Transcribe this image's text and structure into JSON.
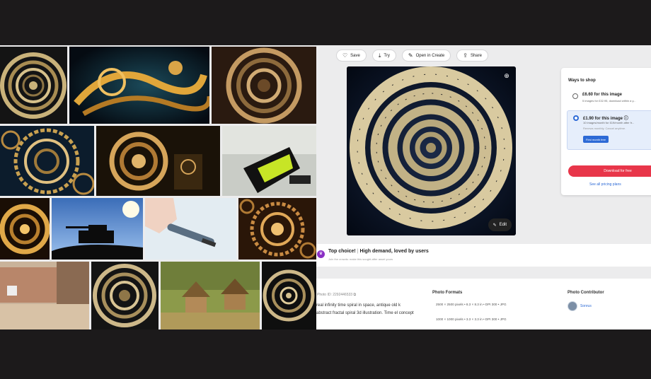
{
  "toolbar": {
    "save": "Save",
    "try": "Try",
    "open_in_create": "Open in Create",
    "share": "Share"
  },
  "preview": {
    "edit_label": "Edit"
  },
  "shop": {
    "title": "Ways to shop",
    "option1_title": "£6.60 for this image",
    "option1_sub": "5 images for £32.95, download within a y...",
    "option2_title": "£1.90 for this image ⓘ",
    "option2_sub": "10 images/month for £19/month after fr...",
    "option2_note": "Renews monthly. Cancel anytime.",
    "trial_button": "First month free",
    "download_button": "Download for free",
    "plans_link": "See all pricing plans"
  },
  "top_choice": {
    "title": "Top choice!",
    "tag": "High demand, loved by users",
    "sub": "Join the crowds: make this sought-after asset yours"
  },
  "details": {
    "photo_id": "Photo ID: 2292446533",
    "description": "real infinity time spiral in space, antique old k abstract fractal spiral 3d illustration. Time el concept",
    "formats_title": "Photo Formats",
    "formats": [
      "2500 × 2500 pixels • 8.3 × 8.3 in • DPI 300 • JPG",
      "1000 × 1000 pixels • 3.3 × 3.3 in • DPI 300 • JPG"
    ],
    "contributor_title": "Photo Contributor",
    "contributor_name": "Sonrus"
  },
  "colors": {
    "accent_blue": "#2d6ad6",
    "download_red": "#e8364a",
    "top_choice_purple": "#8a2fc4"
  }
}
